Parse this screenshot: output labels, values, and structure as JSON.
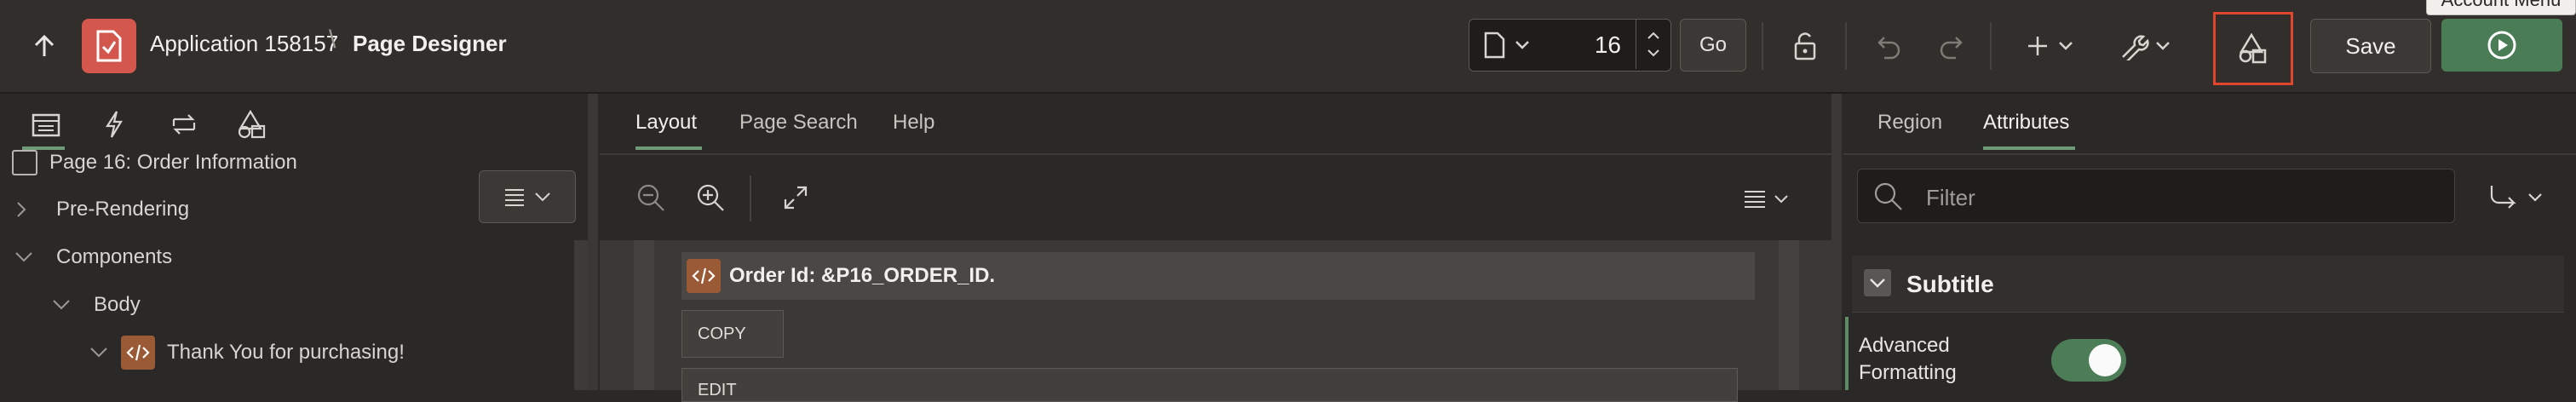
{
  "header": {
    "app_title": "Application 158157",
    "breadcrumb_separator": "\\",
    "page_designer": "Page Designer",
    "page_number": "16",
    "go_label": "Go",
    "save_label": "Save",
    "tooltip": "Account Menu",
    "icons": [
      "up-arrow-icon",
      "app-icon",
      "page-icon",
      "lock-icon",
      "undo-icon",
      "redo-icon",
      "plus-icon",
      "wrench-icon",
      "shared-components-icon",
      "run-icon"
    ]
  },
  "left": {
    "tab_icons": [
      "rendering-icon",
      "dynamic-actions-icon",
      "processing-icon",
      "shared-components-icon"
    ],
    "tree": {
      "root": "Page 16: Order Information",
      "pre_rendering": "Pre-Rendering",
      "components": "Components",
      "body": "Body",
      "region": "Thank You for purchasing!"
    }
  },
  "center": {
    "tabs": [
      "Layout",
      "Page Search",
      "Help"
    ],
    "active_tab": "Layout",
    "region_title": "Order Id: &P16_ORDER_ID.",
    "slots": [
      "COPY",
      "EDIT"
    ]
  },
  "right": {
    "tabs": [
      "Region",
      "Attributes"
    ],
    "active_tab": "Attributes",
    "filter_placeholder": "Filter",
    "section_title": "Subtitle",
    "attribute_label": "Advanced Formatting",
    "attribute_value": true
  },
  "colors": {
    "brand_red": "#d4574e",
    "run_green": "#4a7d55",
    "highlight_red": "#e0452e",
    "active_tab_underline": "#6f9b78"
  }
}
